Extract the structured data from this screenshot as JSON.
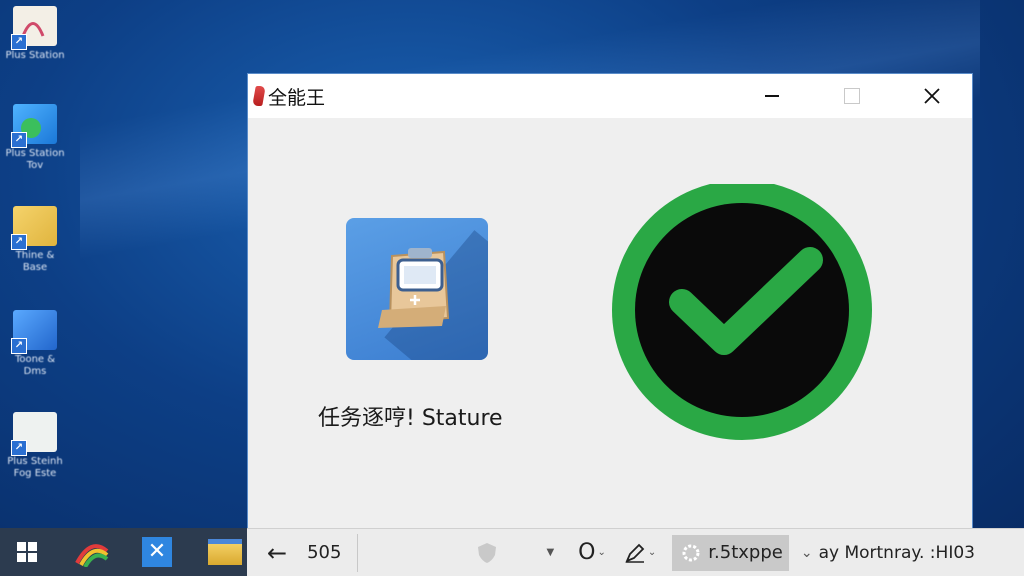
{
  "desktop": {
    "icons": [
      {
        "label_line1": "Plus Station",
        "label_line2": ""
      },
      {
        "label_line1": "Plus Station",
        "label_line2": "Tov"
      },
      {
        "label_line1": "Thine &",
        "label_line2": "Base"
      },
      {
        "label_line1": "Toone &",
        "label_line2": "Dms"
      },
      {
        "label_line1": "Plus Steinh",
        "label_line2": "Fog Este"
      }
    ]
  },
  "window": {
    "title": "全能王",
    "status_text": "任务逐哼!  Stature",
    "icon_names": {
      "app": "app-logo-icon",
      "tile": "clipboard-device-icon",
      "check": "success-check-icon"
    },
    "colors": {
      "tile": "#4a8fdc",
      "check_ring": "#2aa845",
      "check_fill": "#0a0a0a",
      "check_mark": "#2aa845"
    }
  },
  "toolbar": {
    "back_glyph": "←",
    "page_number": "505",
    "search_glyph": "O",
    "sort_value": "r.5txppe",
    "view_text": "ay Mortnray. :HI03"
  }
}
